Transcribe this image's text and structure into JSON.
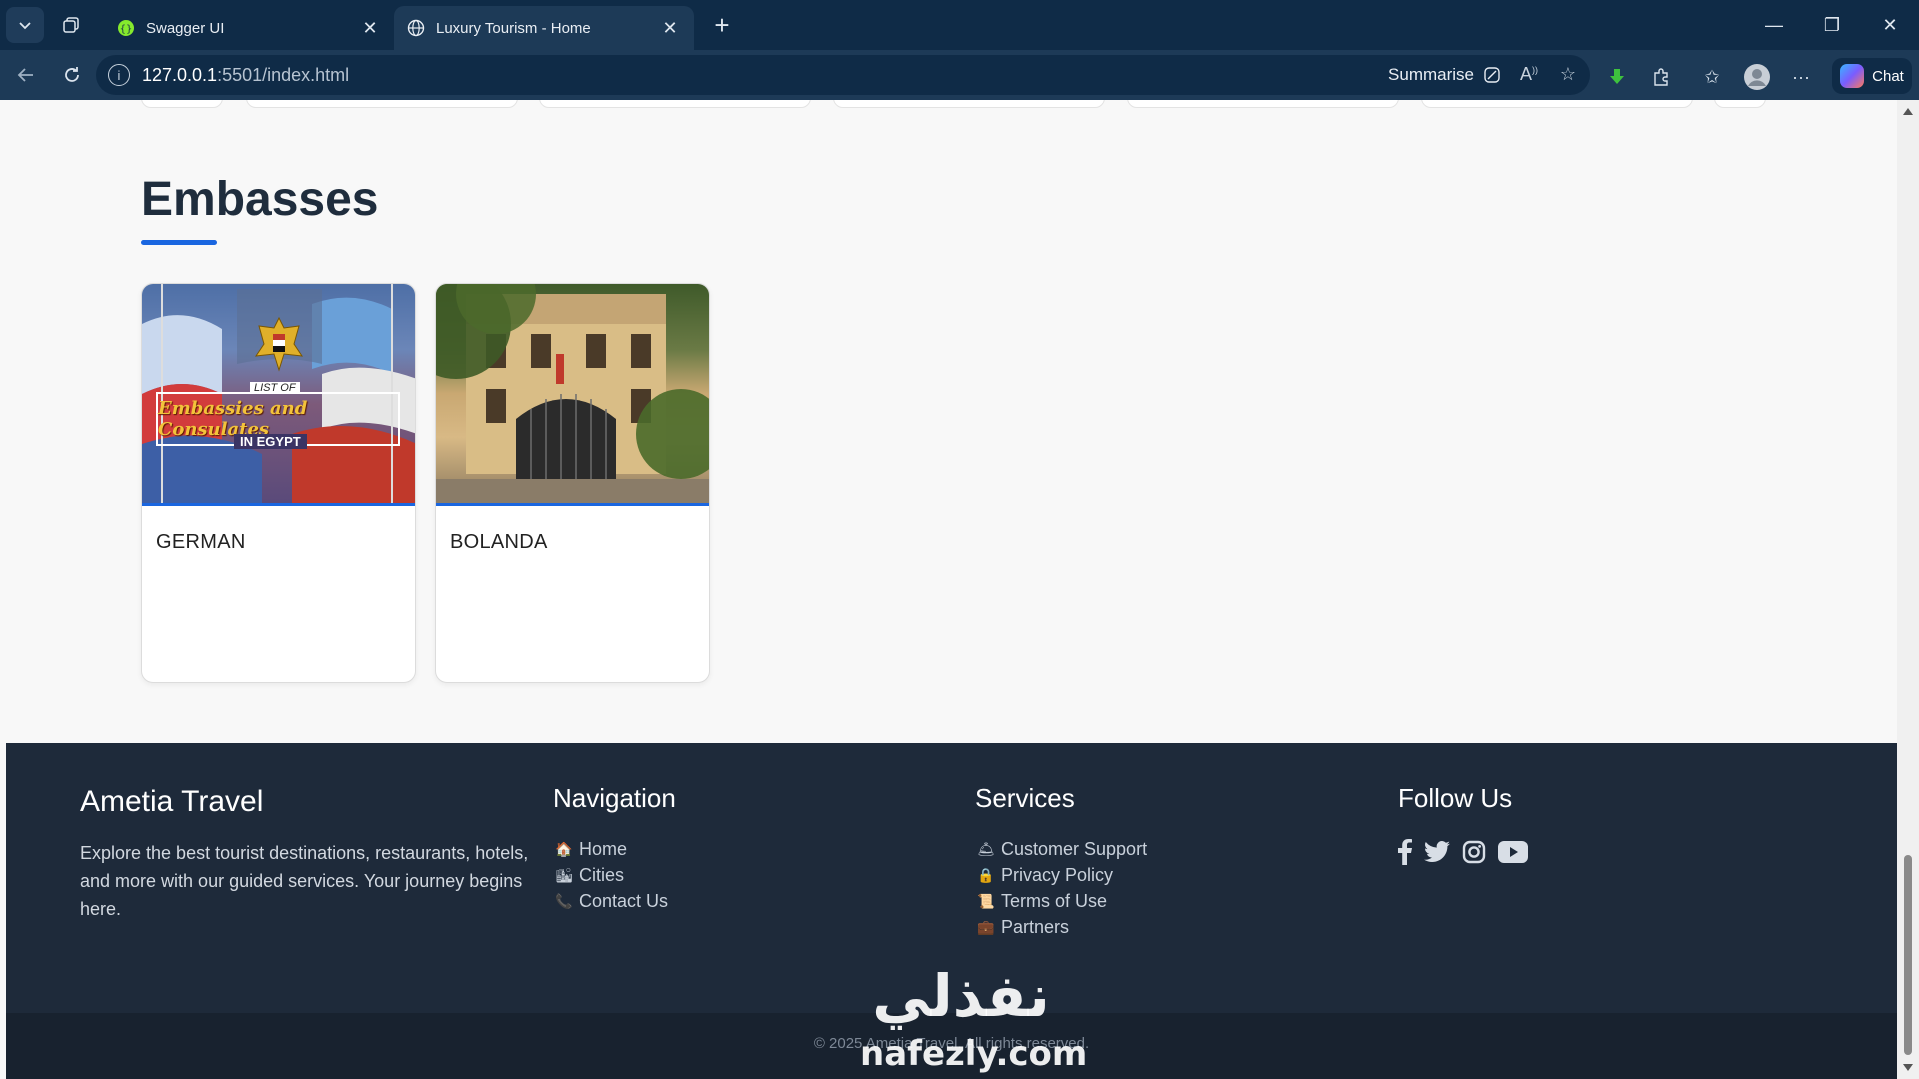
{
  "browser": {
    "tabs": [
      {
        "title": "Swagger UI",
        "icon": "swagger-icon"
      },
      {
        "title": "Luxury Tourism - Home",
        "icon": "globe-icon",
        "active": true
      }
    ],
    "url_host": "127.0.0.1",
    "url_path": ":5501/index.html",
    "summarise_label": "Summarise",
    "chat_label": "Chat"
  },
  "embassies": {
    "title": "Embasses",
    "cards": [
      {
        "name": "GERMAN",
        "image": {
          "list_of": "LIST OF",
          "headline": "Embassies and Consulates",
          "sub": "IN EGYPT"
        }
      },
      {
        "name": "BOLANDA"
      }
    ]
  },
  "footer": {
    "brand": "Ametia Travel",
    "description": "Explore the best tourist destinations, restaurants, hotels, and more with our guided services. Your journey begins here.",
    "navigation": {
      "title": "Navigation",
      "items": [
        {
          "label": "Home",
          "icon": "house-icon"
        },
        {
          "label": "Cities",
          "icon": "cityscape-icon"
        },
        {
          "label": "Contact Us",
          "icon": "phone-icon"
        }
      ]
    },
    "services": {
      "title": "Services",
      "items": [
        {
          "label": "Customer Support",
          "icon": "bell-icon"
        },
        {
          "label": "Privacy Policy",
          "icon": "lock-icon"
        },
        {
          "label": "Terms of Use",
          "icon": "scroll-icon"
        },
        {
          "label": "Partners",
          "icon": "briefcase-icon"
        }
      ]
    },
    "follow": {
      "title": "Follow Us",
      "items": [
        "facebook-icon",
        "twitter-icon",
        "instagram-icon",
        "youtube-icon"
      ]
    },
    "copyright": "© 2025 Ametia Travel. All rights reserved."
  },
  "watermark": {
    "arabic": "نفذلي",
    "latin": "nafezly.com"
  }
}
